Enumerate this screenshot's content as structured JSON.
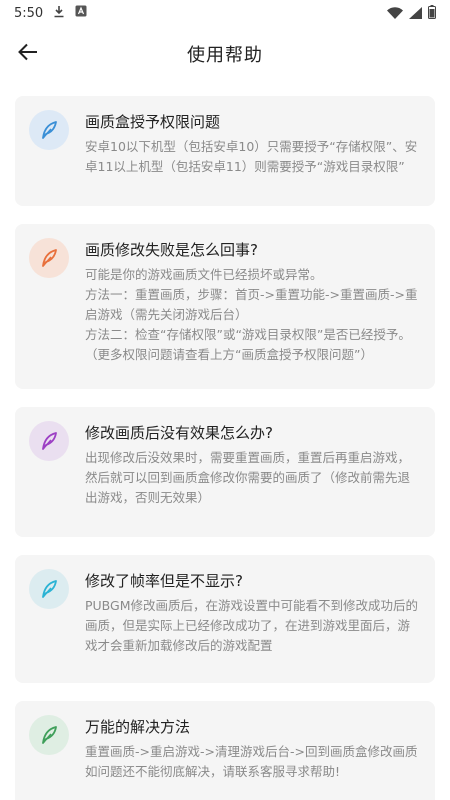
{
  "status_bar": {
    "time": "5:50",
    "icons": [
      "download-icon",
      "a-icon",
      "wifi-icon",
      "signal-icon",
      "battery-icon"
    ]
  },
  "app_bar": {
    "title": "使用帮助",
    "back_icon": "arrow-left-icon"
  },
  "faq": [
    {
      "question": "画质盒授予权限问题",
      "answer": [
        "安卓10以下机型（包括安卓10）只需要授予“存储权限”、安卓11以上机型（包括安卓11）则需要授予“游戏目录权限”"
      ],
      "icon": "feather-icon",
      "icon_color": "#3a8fd6",
      "icon_bg": "#dde9f6"
    },
    {
      "question": "画质修改失败是怎么回事?",
      "answer": [
        "可能是你的游戏画质文件已经损坏或异常。",
        "方法一：重置画质，步骤：首页->重置功能->重置画质->重启游戏（需先关闭游戏后台）",
        "方法二：检查“存储权限”或“游戏目录权限”是否已经授予。（更多权限问题请查看上方“画质盒授予权限问题”）"
      ],
      "icon": "feather-icon",
      "icon_color": "#e8703c",
      "icon_bg": "#f7e2d8"
    },
    {
      "question": "修改画质后没有效果怎么办?",
      "answer": [
        "出现修改后没效果时，需要重置画质，重置后再重启游戏，然后就可以回到画质盒修改你需要的画质了（修改前需先退出游戏，否则无效果）"
      ],
      "icon": "feather-icon",
      "icon_color": "#9c3fc4",
      "icon_bg": "#eadff0"
    },
    {
      "question": "修改了帧率但是不显示?",
      "answer": [
        "PUBGM修改画质后，在游戏设置中可能看不到修改成功后的画质，但是实际上已经修改成功了，在进到游戏里面后，游戏才会重新加载修改后的游戏配置"
      ],
      "icon": "feather-icon",
      "icon_color": "#2bb3d4",
      "icon_bg": "#dcecf0"
    },
    {
      "question": "万能的解决方法",
      "answer": [
        "重置画质->重启游戏->清理游戏后台->回到画质盒修改画质",
        "如问题还不能彻底解决，请联系客服寻求帮助!"
      ],
      "icon": "feather-icon",
      "icon_color": "#3f9f5a",
      "icon_bg": "#dfeee3"
    }
  ]
}
